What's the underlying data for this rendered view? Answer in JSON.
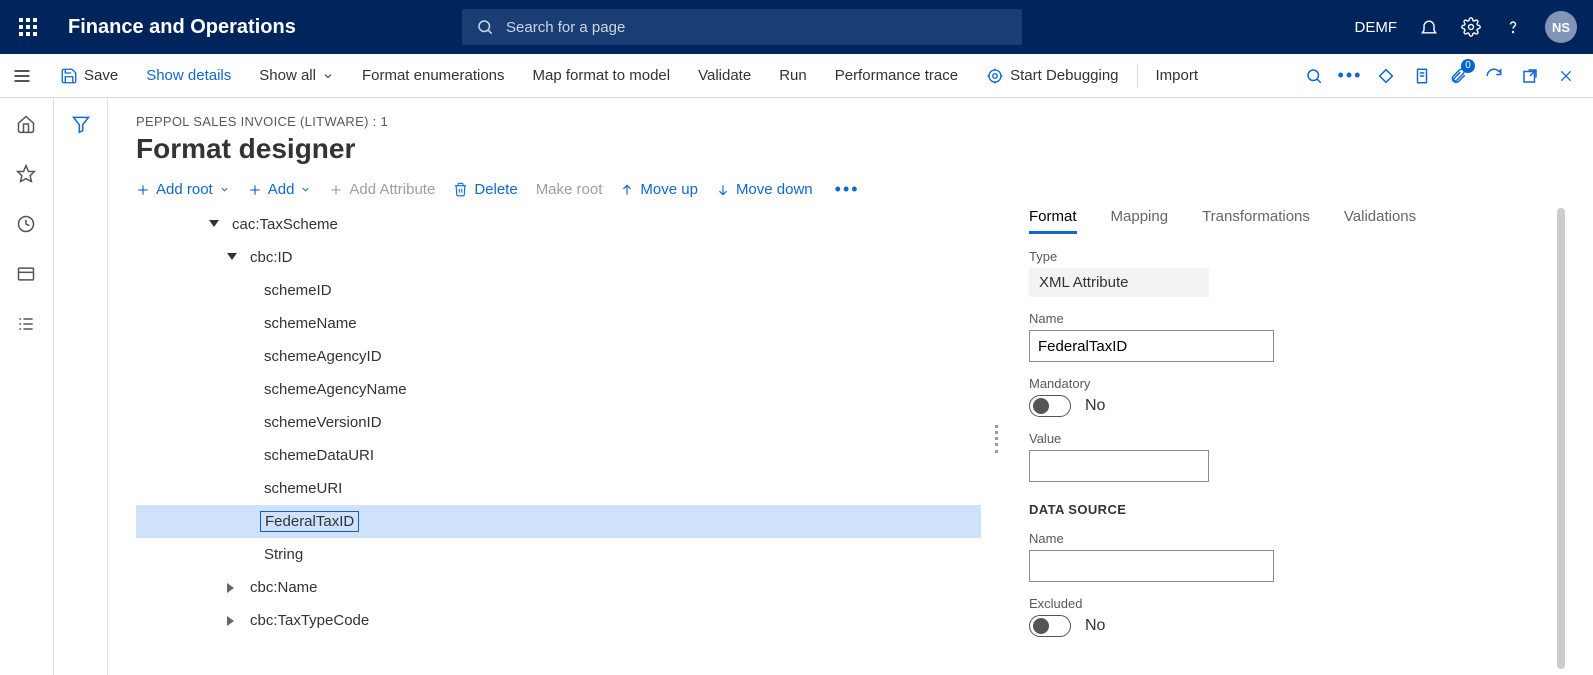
{
  "header": {
    "app_title": "Finance and Operations",
    "search_placeholder": "Search for a page",
    "company": "DEMF",
    "avatar_initials": "NS"
  },
  "actionbar": {
    "save": "Save",
    "show_details": "Show details",
    "show_all": "Show all",
    "format_enum": "Format enumerations",
    "map_format": "Map format to model",
    "validate": "Validate",
    "run": "Run",
    "perf_trace": "Performance trace",
    "start_debug": "Start Debugging",
    "import": "Import",
    "attach_badge": "0"
  },
  "page": {
    "breadcrumb": "PEPPOL SALES INVOICE (LITWARE) : 1",
    "title": "Format designer"
  },
  "treetoolbar": {
    "add_root": "Add root",
    "add": "Add",
    "add_attr": "Add Attribute",
    "delete": "Delete",
    "make_root": "Make root",
    "move_up": "Move up",
    "move_down": "Move down"
  },
  "tree": {
    "n1": "cac:TaxScheme",
    "n2": "cbc:ID",
    "n3": "schemeID",
    "n4": "schemeName",
    "n5": "schemeAgencyID",
    "n6": "schemeAgencyName",
    "n7": "schemeVersionID",
    "n8": "schemeDataURI",
    "n9": "schemeURI",
    "n10": "FederalTaxID",
    "n11": "String",
    "n12": "cbc:Name",
    "n13": "cbc:TaxTypeCode"
  },
  "tabs": {
    "format": "Format",
    "mapping": "Mapping",
    "transformations": "Transformations",
    "validations": "Validations"
  },
  "props": {
    "type_label": "Type",
    "type_value": "XML Attribute",
    "name_label": "Name",
    "name_value": "FederalTaxID",
    "mandatory_label": "Mandatory",
    "mandatory_value": "No",
    "value_label": "Value",
    "value_value": "",
    "ds_section": "DATA SOURCE",
    "ds_name_label": "Name",
    "ds_name_value": "",
    "excluded_label": "Excluded",
    "excluded_value": "No"
  }
}
